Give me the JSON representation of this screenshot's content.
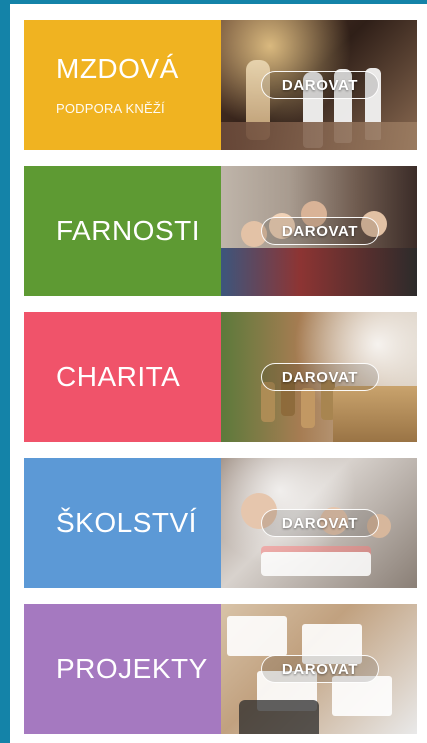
{
  "cards": [
    {
      "title": "MZDOVÁ",
      "subtitle": "PODPORA KNĚŽÍ",
      "button_label": "DAROVAT",
      "color": "#F0B321",
      "photo": "priests-in-church"
    },
    {
      "title": "FARNOSTI",
      "subtitle": "",
      "button_label": "DAROVAT",
      "color": "#5E9A33",
      "photo": "family-with-priest"
    },
    {
      "title": "CHARITA",
      "subtitle": "",
      "button_label": "DAROVAT",
      "color": "#F0536A",
      "photo": "food-donations"
    },
    {
      "title": "ŠKOLSTVÍ",
      "subtitle": "",
      "button_label": "DAROVAT",
      "color": "#5C99D6",
      "photo": "teacher-with-children"
    },
    {
      "title": "PROJEKTY",
      "subtitle": "",
      "button_label": "DAROVAT",
      "color": "#A579C0",
      "photo": "desk-with-charts"
    }
  ]
}
